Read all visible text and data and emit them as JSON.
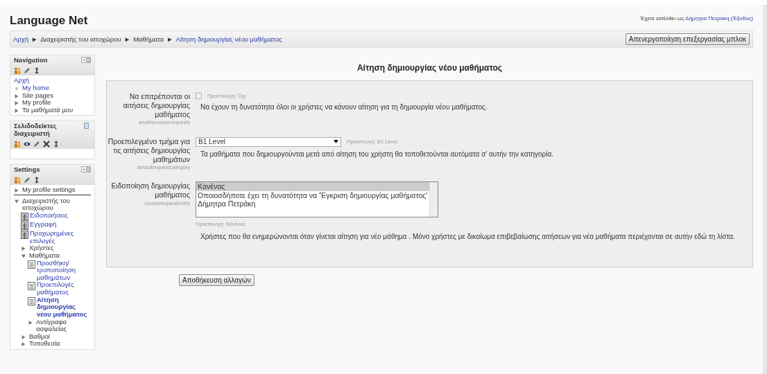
{
  "site_title": "Language Net",
  "login": {
    "prefix": "Έχετε εισέλθει ως",
    "user": "Δήμητρα Πετράκη",
    "logout": "(Έξοδος)"
  },
  "breadcrumb": [
    {
      "label": "Αρχή",
      "link": true
    },
    {
      "label": "Διαχειριστής του ιστοχώρου",
      "link": false
    },
    {
      "label": "Μαθήματα",
      "link": false
    },
    {
      "label": "Αίτηση δημιουργίας νέου μαθήματος",
      "link": true
    }
  ],
  "breadcrumb_separator": "►",
  "edit_blocks_button": "Απενεργοποίηση επεξεργασίας μπλοκ",
  "blocks": [
    {
      "title": "Navigation",
      "docked": false,
      "tools": [
        {
          "kind": "person"
        },
        {
          "kind": "pencil"
        },
        {
          "kind": "move"
        }
      ],
      "items": [
        {
          "label": "Αρχή",
          "kind": "root",
          "link": true,
          "active": false
        },
        {
          "label": "My home",
          "kind": "bullet",
          "link": true,
          "active": false
        },
        {
          "label": "Site pages",
          "kind": "branch",
          "expanded": false,
          "link": false,
          "active": false
        },
        {
          "label": "My profile",
          "kind": "branch",
          "expanded": false,
          "link": false,
          "active": false
        },
        {
          "label": "Τα μαθήματά μου",
          "kind": "branch",
          "expanded": false,
          "link": false,
          "active": false
        }
      ]
    },
    {
      "title": "Σελιδοδείκτες διαχειριστή",
      "docked": true,
      "tools": [
        {
          "kind": "person"
        },
        {
          "kind": "eye"
        },
        {
          "kind": "pencil"
        },
        {
          "kind": "delete"
        },
        {
          "kind": "move"
        }
      ]
    },
    {
      "title": "Settings",
      "docked": false,
      "tools": [
        {
          "kind": "person"
        },
        {
          "kind": "pencil"
        },
        {
          "kind": "move"
        }
      ],
      "items": [
        {
          "label": "My profile settings",
          "kind": "branch",
          "expanded": false,
          "link": false,
          "active": false,
          "rule_below": true
        },
        {
          "label": "Διαχειριστής του ιστοχώρου",
          "kind": "branch",
          "expanded": true,
          "link": false,
          "active": false,
          "children": [
            {
              "label": "Ειδοποιήσεις",
              "kind": "admin-page",
              "link": true,
              "active": false
            },
            {
              "label": "Εγγραφή",
              "kind": "admin-page",
              "link": true,
              "active": false
            },
            {
              "label": "Προχωρημένες επιλογές",
              "kind": "admin-page",
              "link": true,
              "active": false
            },
            {
              "label": "Χρήστες",
              "kind": "branch",
              "expanded": false,
              "link": false,
              "active": false
            },
            {
              "label": "Μαθήματα",
              "kind": "branch",
              "expanded": true,
              "link": false,
              "active": false,
              "children": [
                {
                  "label": "Προσθήκη/ τροποποίηση μαθημάτων",
                  "kind": "page",
                  "link": true,
                  "active": false
                },
                {
                  "label": "Προεπιλογές μαθήματος",
                  "kind": "page",
                  "link": true,
                  "active": false
                },
                {
                  "label": "Αίτηση δημιουργίας νέου μαθήματος",
                  "kind": "page",
                  "link": true,
                  "active": true
                },
                {
                  "label": "Αντίγραφα ασφαλείας",
                  "kind": "branch",
                  "expanded": false,
                  "link": false,
                  "active": false
                }
              ]
            },
            {
              "label": "Βαθμοί",
              "kind": "branch",
              "expanded": false,
              "link": false,
              "active": false
            },
            {
              "label": "Τοποθεσία",
              "kind": "branch",
              "expanded": false,
              "link": false,
              "active": false
            }
          ]
        }
      ]
    }
  ],
  "page_heading": "Αίτηση δημιουργίας νέου μαθήματος",
  "settings": [
    {
      "kind": "checkbox",
      "label": "Να επιτρέπονται οι αιτήσεις δημιουργίας μαθήματος",
      "name": "enablecourserequests",
      "checked": false,
      "default": "Προεπιλογή: Όχι",
      "description": "Να έχουν τη δυνατότητα όλοι οι χρήστες να κάνουν αίτηση για τη δημιουργία νέου μαθήματος."
    },
    {
      "kind": "select",
      "label": "Προεπιλεγμένο τμήμα για τις αιτήσεις δημιουργίας μαθημάτων",
      "name": "defaultrequestcategory",
      "value": "B1 Level",
      "default": "Προεπιλογή: B1 Level",
      "description": "Τα μαθήματα που δημιουργούνται μετά από αίτηση του χρήστη θα τοποθετούνται αυτόματα σ' αυτήν την κατηγορία."
    },
    {
      "kind": "multiselect",
      "label": "Ειδοποίηση δημιουργίας μαθήματος",
      "name": "courserequestnotify",
      "options": [
        {
          "label": "Κανένας",
          "selected": true
        },
        {
          "label": "Οποιοσδήποτε έχει τη δυνατότητα να 'Έγκριση δημιουργίας μαθήματος'",
          "selected": false
        },
        {
          "label": "Δήμητρα Πετράκη",
          "selected": false
        }
      ],
      "default": "Προεπιλογή: Κανένας",
      "description": "Χρήστες που θα ενημερώνονται όταν γίνεται αίτηση για νέο μάθημα . Μόνο χρήστες με δικαίωμα επιβεβαίωσης αιτήσεων για νέα μαθήματα περιέχονται σε αυτήν εδώ τη λίστα."
    }
  ],
  "save_button": "Αποθήκευση αλλαγών"
}
